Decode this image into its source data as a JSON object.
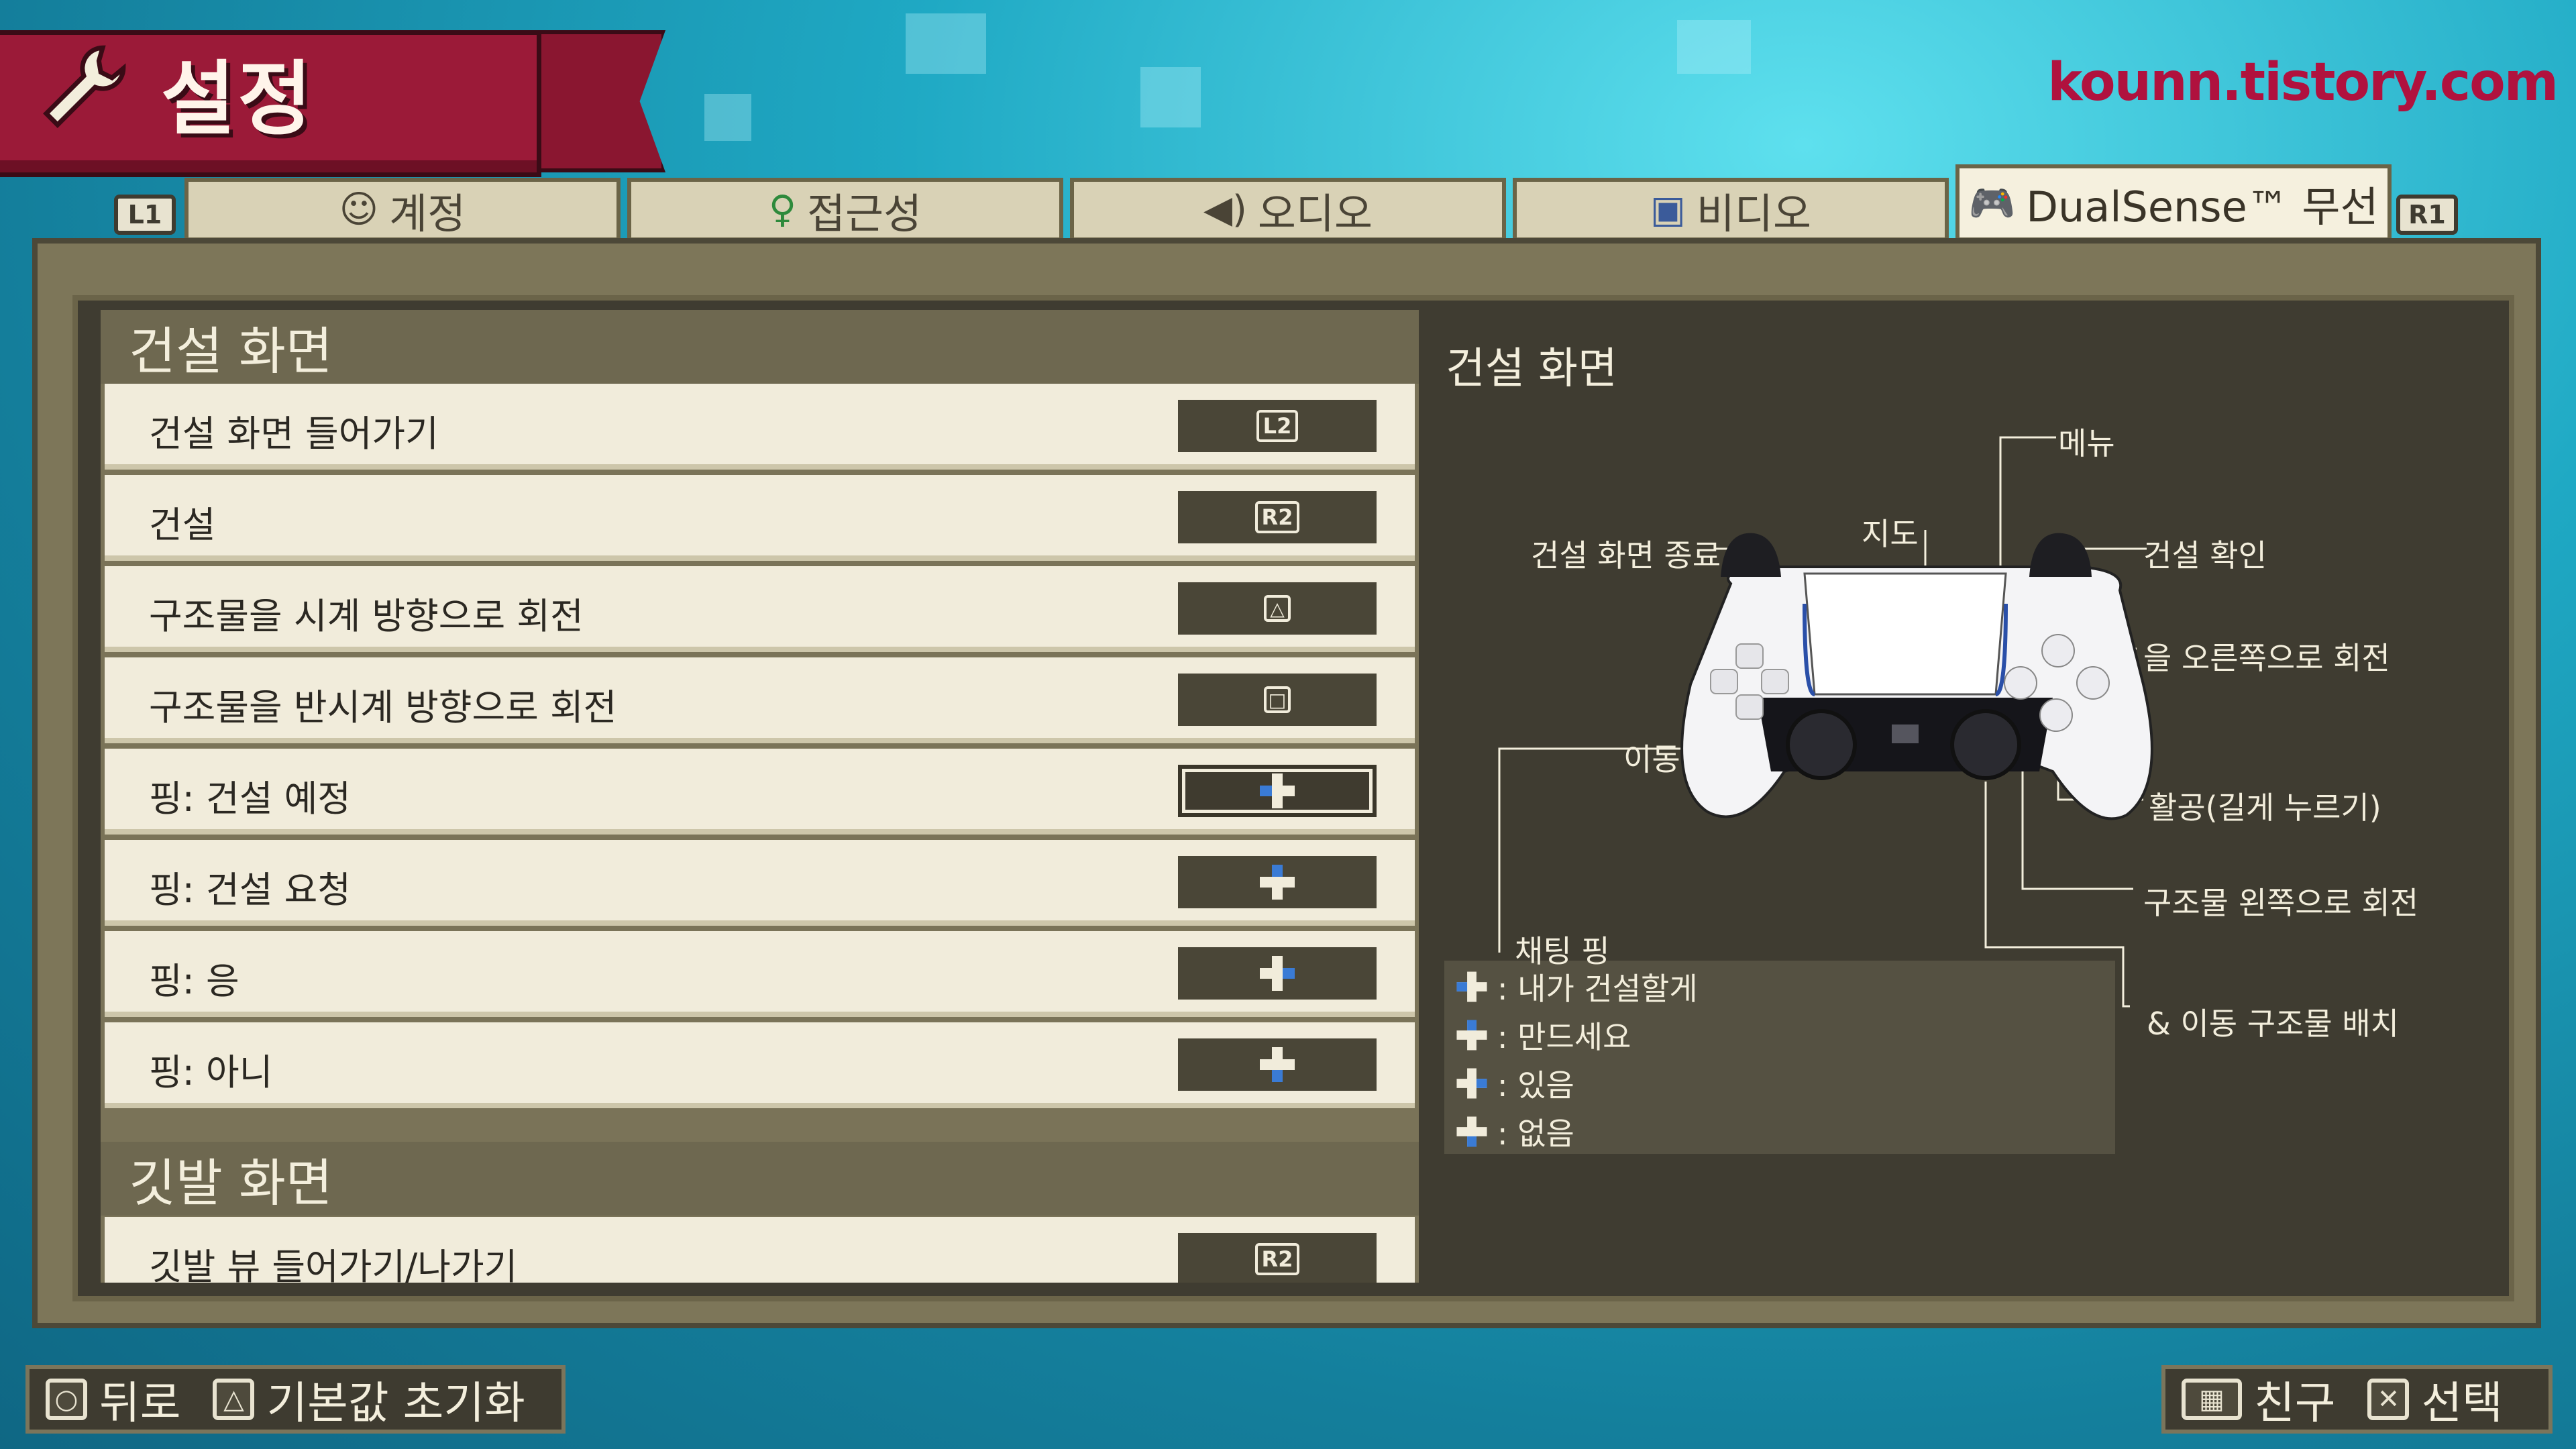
{
  "header": {
    "title": "설정",
    "watermark": "kounn.tistory.com"
  },
  "shoulder": {
    "left": "L1",
    "right": "R1"
  },
  "tabs": [
    {
      "label": "계정",
      "icon": "person-icon"
    },
    {
      "label": "접근성",
      "icon": "accessibility-icon"
    },
    {
      "label": "오디오",
      "icon": "speaker-icon"
    },
    {
      "label": "비디오",
      "icon": "monitor-icon"
    },
    {
      "label": "DualSense™ 무선",
      "icon": "gamepad-icon",
      "active": true
    }
  ],
  "sections": [
    {
      "title": "건설 화면",
      "rows": [
        {
          "label": "건설 화면 들어가기",
          "binding": "L2"
        },
        {
          "label": "건설",
          "binding": "R2"
        },
        {
          "label": "구조물을 시계 방향으로 회전",
          "binding": "△"
        },
        {
          "label": "구조물을 반시계 방향으로 회전",
          "binding": "□"
        },
        {
          "label": "핑: 건설 예정",
          "binding": "dpad-left",
          "selected": true
        },
        {
          "label": "핑: 건설 요청",
          "binding": "dpad-up"
        },
        {
          "label": "핑: 응",
          "binding": "dpad-right"
        },
        {
          "label": "핑: 아니",
          "binding": "dpad-down"
        }
      ]
    },
    {
      "title": "깃발 화면",
      "rows": [
        {
          "label": "깃발 뷰 들어가기/나가기",
          "binding": "R2"
        }
      ]
    }
  ],
  "diagram": {
    "title": "건설 화면",
    "labels": {
      "menu": "메뉴",
      "map": "지도",
      "exit": "건설 화면 종료",
      "confirm": "건설 확인",
      "rotate_right": "을 오른쪽으로 회전",
      "move": "이동",
      "activate": "활공(길게 누르기)",
      "rotate_left": "구조물 왼쪽으로 회전",
      "place": "&  이동 구조물 배치"
    },
    "chat": {
      "title": "채팅 핑",
      "items": [
        ": 내가 건설할게",
        ": 만드세요",
        ": 있음",
        ": 없음"
      ]
    }
  },
  "footer": {
    "back": "뒤로",
    "reset": "기본값 초기화",
    "friends": "친구",
    "select": "선택"
  },
  "colors": {
    "banner": "#9b1a38",
    "watermark": "#b0123e",
    "panel": "#3f3c31",
    "row": "#f1ecdb"
  }
}
